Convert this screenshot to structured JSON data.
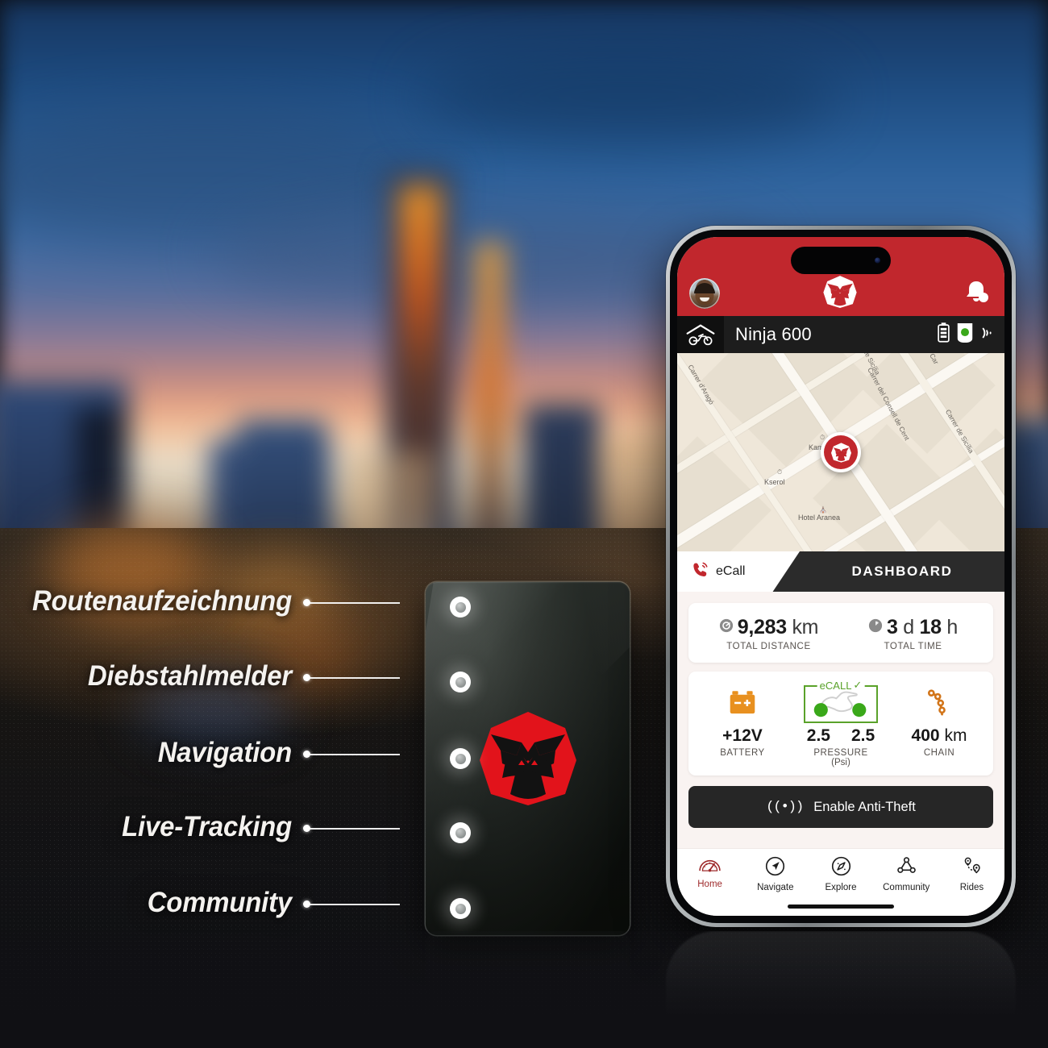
{
  "brand": {
    "name": "gorilla-logo",
    "primary": "#c1272d",
    "dark": "#1d1d1d",
    "accent_green": "#5aa22a",
    "accent_orange": "#e8901f"
  },
  "features": [
    {
      "label": "Routenaufzeichnung"
    },
    {
      "label": "Diebstahlmelder"
    },
    {
      "label": "Navigation"
    },
    {
      "label": "Live-Tracking"
    },
    {
      "label": "Community"
    }
  ],
  "app": {
    "header": {
      "avatar": "user-avatar",
      "logo": "gorilla-logo",
      "notifications_icon": "bell-icon"
    },
    "vehicle_bar": {
      "garage_icon": "garage-motorcycle-icon",
      "vehicle_name": "Ninja 600",
      "battery_icon": "battery-icon",
      "tracker_icon": "tracker-online-icon",
      "signal_icon": "signal-waves-icon"
    },
    "map": {
      "marker": "gorilla-map-marker",
      "street_labels": [
        "Carrer d'Aragó",
        "de Sicília",
        "Carrer del Consell de Cent",
        "Carrer de Sicília",
        "Car"
      ],
      "pois": [
        {
          "name": "Kam",
          "pin": "11"
        },
        {
          "name": "Kserol",
          "pin": "11"
        },
        {
          "name": "Hotel Aranea",
          "pin": "os"
        }
      ]
    },
    "tabs": [
      {
        "label": "eCall",
        "icon": "phone-call-icon",
        "active": false
      },
      {
        "label": "DASHBOARD",
        "active": true
      }
    ],
    "totals": [
      {
        "icon": "speedometer-icon",
        "value": "9,283",
        "unit": "km",
        "caption": "TOTAL DISTANCE"
      },
      {
        "icon": "clock-icon",
        "value_a": "3",
        "unit_a": "d",
        "value_b": "18",
        "unit_b": "h",
        "caption": "TOTAL TIME"
      }
    ],
    "stats": [
      {
        "icon": "battery-12v-icon",
        "value": "+12V",
        "caption": "BATTERY"
      },
      {
        "icon": "motorcycle-tire-pressure-icon",
        "tag": "eCALL",
        "tag_check": "✓",
        "value_front": "2.5",
        "value_rear": "2.5",
        "caption": "PRESSURE",
        "caption2": "(Psi)"
      },
      {
        "icon": "chain-icon",
        "value": "400",
        "unit": "km",
        "caption": "CHAIN"
      }
    ],
    "anti_theft": {
      "icon": "broadcast-icon",
      "glyph": "((•))",
      "label": "Enable Anti-Theft"
    },
    "bottom_nav": [
      {
        "icon": "speedometer-icon",
        "label": "Home",
        "active": true
      },
      {
        "icon": "navigate-arrow-icon",
        "label": "Navigate",
        "active": false
      },
      {
        "icon": "compass-icon",
        "label": "Explore",
        "active": false
      },
      {
        "icon": "community-nodes-icon",
        "label": "Community",
        "active": false
      },
      {
        "icon": "route-pins-icon",
        "label": "Rides",
        "active": false
      }
    ]
  },
  "device": {
    "name": "gps-tracker-device",
    "logo": "gorilla-logo",
    "port_count": 5
  }
}
